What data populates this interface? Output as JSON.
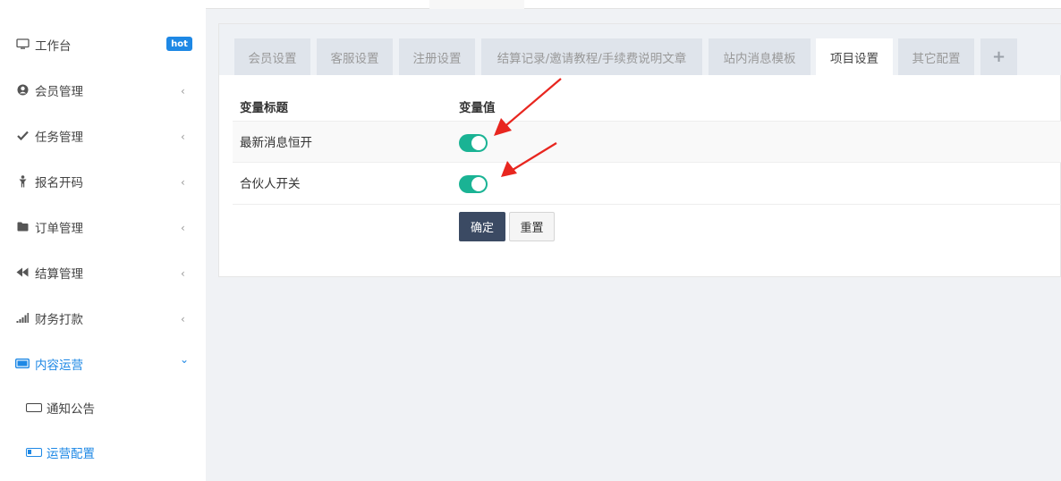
{
  "sidebar": {
    "items": [
      {
        "label": "工作台",
        "icon": "monitor-icon",
        "badge": "hot"
      },
      {
        "label": "会员管理",
        "icon": "user-circle-icon"
      },
      {
        "label": "任务管理",
        "icon": "check-icon"
      },
      {
        "label": "报名开码",
        "icon": "person-icon"
      },
      {
        "label": "订单管理",
        "icon": "folder-icon"
      },
      {
        "label": "结算管理",
        "icon": "backward-icon"
      },
      {
        "label": "财务打款",
        "icon": "signal-bars-icon"
      },
      {
        "label": "内容运营",
        "icon": "display-icon",
        "expanded": true
      }
    ],
    "subitems": [
      {
        "label": "通知公告",
        "icon": "rectangle-icon"
      },
      {
        "label": "运营配置",
        "icon": "rectangle-half-icon",
        "active": true
      }
    ],
    "collapse_glyph": "‹",
    "expand_glyph": "⌄"
  },
  "tabs": [
    {
      "label": "会员设置"
    },
    {
      "label": "客服设置"
    },
    {
      "label": "注册设置"
    },
    {
      "label": "结算记录/邀请教程/手续费说明文章"
    },
    {
      "label": "站内消息模板"
    },
    {
      "label": "项目设置",
      "active": true
    },
    {
      "label": "其它配置"
    },
    {
      "label": "+"
    }
  ],
  "table": {
    "headers": [
      "变量标题",
      "变量值"
    ],
    "rows": [
      {
        "label": "最新消息恒开",
        "value": true
      },
      {
        "label": "合伙人开关",
        "value": true
      }
    ]
  },
  "buttons": {
    "confirm": "确定",
    "reset": "重置"
  },
  "colors": {
    "accent": "#1e88e5",
    "switch_on": "#1ab394",
    "confirm_bg": "#3b4a63",
    "annotation_arrow": "#e8261f"
  }
}
